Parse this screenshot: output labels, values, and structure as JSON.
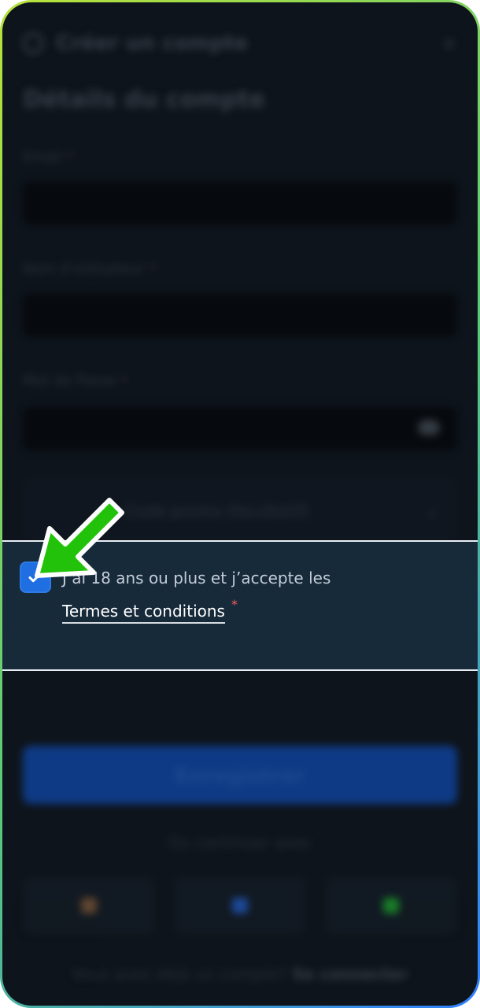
{
  "background": {
    "header": {
      "title": "Créer un compte",
      "close_glyph": "×",
      "user_icon": "user-icon"
    },
    "section_title": "Détails du compte",
    "fields": [
      {
        "label": "Email",
        "required_mark": "*"
      },
      {
        "label": "Nom d'utilisateur",
        "required_mark": "*"
      },
      {
        "label": "Mot de Passe",
        "required_mark": "*"
      }
    ],
    "select": {
      "text": "Code promo (facultatif)",
      "chevron_glyph": "⌄"
    },
    "cta_label": "Enregistrer",
    "alt_text": "Ou continuer avec",
    "social": [
      {
        "name": "google-icon",
        "color": "#6b4c33"
      },
      {
        "name": "facebook-icon",
        "color": "#1f4fa8"
      },
      {
        "name": "line-icon",
        "color": "#1a8a2a"
      }
    ],
    "login_prompt": "Vous avez déjà un compte?",
    "login_link": "Se connecter"
  },
  "terms": {
    "checked": true,
    "line1": "J’ai 18 ans ou plus et j’accepte les",
    "link": "Termes et conditions",
    "required_mark": "*"
  },
  "colors": {
    "checkbox": "#1f6fe3",
    "arrow": "#22c20a",
    "required": "#ff5a5a",
    "panel": "#162a3a"
  },
  "annotations": {
    "arrow_icon": "green-arrow-icon"
  }
}
